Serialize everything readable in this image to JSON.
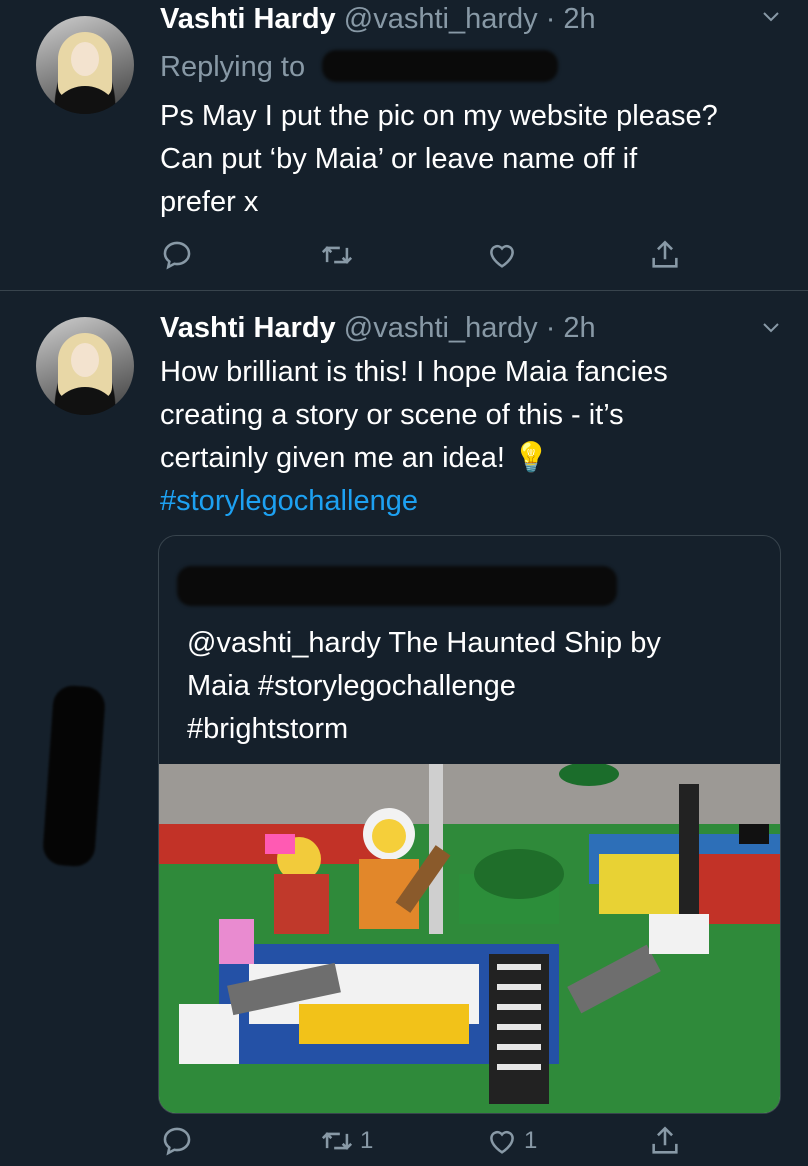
{
  "tweets": [
    {
      "author_name": "Vashti Hardy",
      "author_handle": "@vashti_hardy",
      "time": "· 2h",
      "replying_to": "Replying to",
      "lines": [
        "Ps May I put the pic on my website please?",
        "Can put ‘by Maia’ or leave name off if",
        "prefer x"
      ],
      "actions": {
        "reply_count": "",
        "retweet_count": "",
        "like_count": ""
      }
    },
    {
      "author_name": "Vashti Hardy",
      "author_handle": "@vashti_hardy",
      "time": "· 2h",
      "lines": [
        "How brilliant is this! I hope Maia fancies",
        "creating a story or scene of this - it’s",
        "certainly given me an  idea! "
      ],
      "idea_emoji": "💡",
      "hashtag": "#storylegochallenge",
      "quoted": {
        "lines": [
          "@vashti_hardy The Haunted Ship by",
          "Maia #storylegochallenge",
          "#brightstorm"
        ]
      },
      "actions": {
        "reply_count": "",
        "retweet_count": "1",
        "like_count": "1"
      }
    }
  ],
  "icons": [
    "reply-icon",
    "retweet-icon",
    "like-icon",
    "share-icon",
    "chevron-down-icon"
  ],
  "colors": {
    "background": "#15202b",
    "secondary_text": "#8899a6",
    "link": "#1da1f2",
    "divider": "#38444d"
  }
}
